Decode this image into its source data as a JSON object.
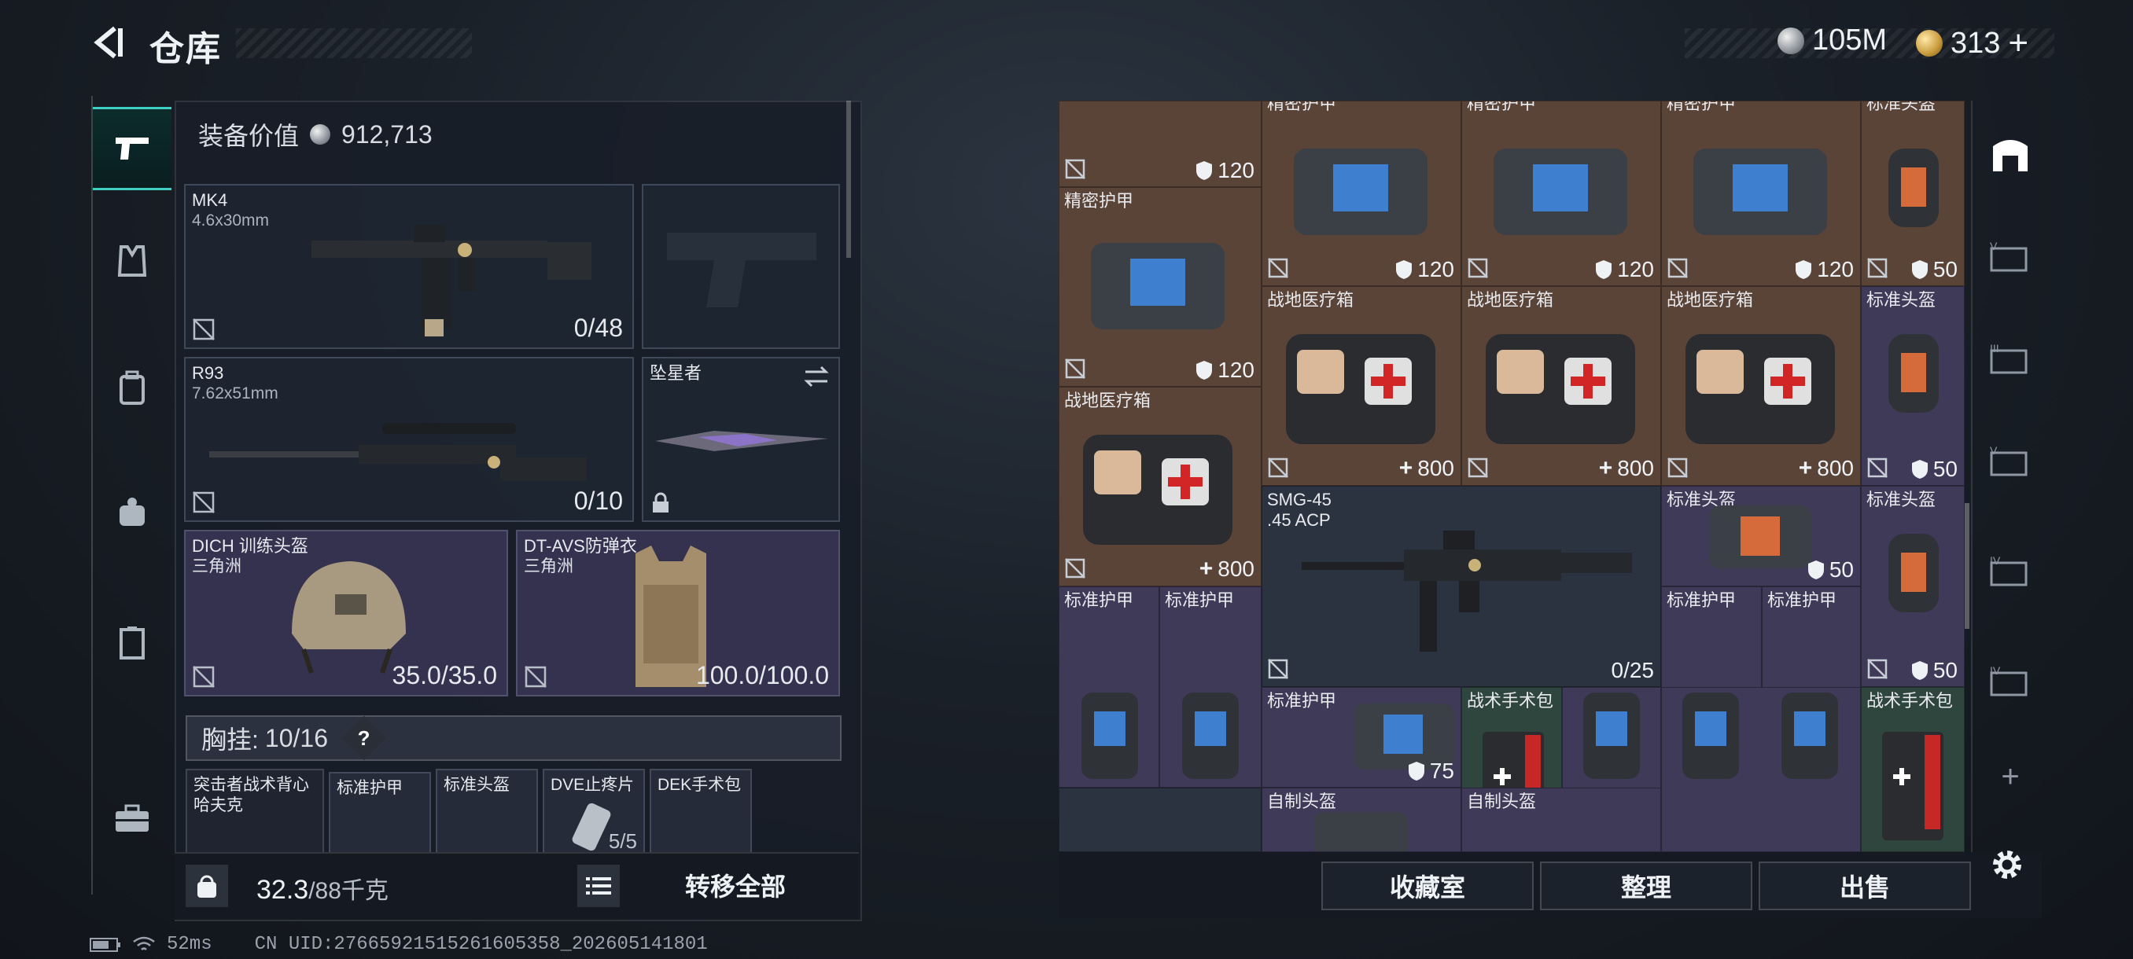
{
  "header": {
    "title": "仓库",
    "currency_silver": "105M",
    "currency_gold": "313",
    "add_symbol": "+"
  },
  "loadout": {
    "value_label": "装备价值",
    "value": "912,713",
    "primary": {
      "name": "MK4",
      "caliber": "4.6x30mm",
      "ammo": "0/48"
    },
    "secondary": {
      "name": "R93",
      "caliber": "7.62x51mm",
      "ammo": "0/10"
    },
    "melee": {
      "name": "坠星者"
    },
    "helmet": {
      "name": "DICH 训练头盔",
      "origin": "三角洲",
      "durability": "35.0/35.0"
    },
    "armor": {
      "name": "DT-AVS防弹衣",
      "origin": "三角洲",
      "durability": "100.0/100.0"
    },
    "rig": {
      "label": "胸挂:",
      "capacity": "10/16",
      "help": "?"
    },
    "rig_items": [
      {
        "name": "突击者战术背心",
        "sub": "哈夫克"
      },
      {
        "name": "标准护甲"
      },
      {
        "name": "标准头盔"
      },
      {
        "name": "DVE止疼片",
        "count": "5/5"
      },
      {
        "name": "DEK手术包"
      }
    ],
    "weight": "32.3",
    "weight_max": "/88千克",
    "transfer_all": "转移全部"
  },
  "stash": {
    "cells": [
      {
        "name": "",
        "val": "120",
        "type": "shield"
      },
      {
        "name": "精密护甲",
        "val": "120",
        "type": "shield"
      },
      {
        "name": "精密护甲",
        "val": "120",
        "type": "shield"
      },
      {
        "name": "精密护甲",
        "val": "120",
        "type": "shield"
      },
      {
        "name": "精密护甲",
        "val": "120",
        "type": "shield"
      },
      {
        "name": "标准头盔",
        "val": "50",
        "type": "shield"
      },
      {
        "name": "战地医疗箱",
        "val": "800",
        "type": "plus"
      },
      {
        "name": "战地医疗箱",
        "val": "800",
        "type": "plus"
      },
      {
        "name": "战地医疗箱",
        "val": "800",
        "type": "plus"
      },
      {
        "name": "战地医疗箱",
        "val": "800",
        "type": "plus"
      },
      {
        "name": "标准头盔",
        "val": "50",
        "type": "shield"
      },
      {
        "name": "SMG-45",
        "sub": ".45 ACP",
        "val": "0/25",
        "type": "ammo"
      },
      {
        "name": "标准头盔",
        "val": "50",
        "type": "shield"
      },
      {
        "name": "标准头盔",
        "val": "50",
        "type": "shield"
      },
      {
        "name": "标准护甲",
        "val": "",
        "type": "none"
      },
      {
        "name": "标准护甲",
        "val": "",
        "type": "none"
      },
      {
        "name": "标准护甲",
        "val": "",
        "type": "none"
      },
      {
        "name": "标准护甲",
        "val": "",
        "type": "none"
      },
      {
        "name": "标准护甲",
        "val": "75",
        "type": "shield"
      },
      {
        "name": "战术手术包",
        "val": "",
        "type": "none"
      },
      {
        "name": "战术手术包",
        "val": "",
        "type": "none"
      },
      {
        "name": "自制头盔",
        "val": "",
        "type": "none"
      },
      {
        "name": "自制头盔",
        "val": "",
        "type": "none"
      }
    ],
    "collection_button": "收藏室",
    "sort_button": "整理",
    "sell_button": "出售",
    "side_add": "+"
  },
  "status": {
    "ping": "52ms",
    "uid": "CN UID:27665921515261605358_202605141801"
  },
  "colors": {
    "accent": "#3fd0c4",
    "brown_cell": "#5a4438",
    "purple_cell": "#3f3a58"
  }
}
